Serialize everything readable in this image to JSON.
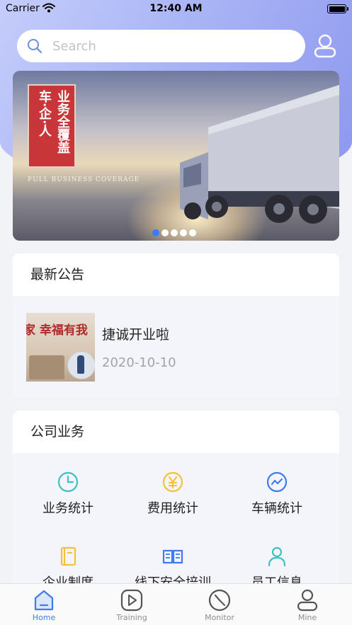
{
  "status_bar": {
    "carrier": "Carrier",
    "time": "12:40 AM",
    "wifi_icon": "wifi-icon",
    "battery_icon": "battery-icon"
  },
  "search": {
    "placeholder": "Search",
    "icon": "search-icon"
  },
  "profile_icon": "user-icon",
  "banner": {
    "seal_col1": "车·企·人",
    "seal_col2": "业务全覆盖",
    "subtitle": "FULL BUSINESS COVERAGE",
    "page_count": 5,
    "active_page": 1
  },
  "notice": {
    "title": "最新公告",
    "items": [
      {
        "thumb_text": "家 幸福有我",
        "title": "捷诚开业啦",
        "date": "2020-10-10"
      }
    ]
  },
  "business": {
    "title": "公司业务",
    "items": [
      {
        "label": "业务统计",
        "icon": "pie-chart-icon",
        "color": "#3fc1c1"
      },
      {
        "label": "费用统计",
        "icon": "yuan-icon",
        "color": "#f3c03a"
      },
      {
        "label": "车辆统计",
        "icon": "trend-icon",
        "color": "#3d7cf0"
      },
      {
        "label": "企业制度",
        "icon": "book-icon",
        "color": "#f3c03a"
      },
      {
        "label": "线下安全培训",
        "icon": "open-book-icon",
        "color": "#3d7cf0"
      },
      {
        "label": "员工信息",
        "icon": "person-icon",
        "color": "#3fc1c1"
      }
    ]
  },
  "tabbar": {
    "active": "Home",
    "items": [
      {
        "label": "Home",
        "icon": "home-icon"
      },
      {
        "label": "Training",
        "icon": "play-icon"
      },
      {
        "label": "Monitor",
        "icon": "gauge-icon"
      },
      {
        "label": "Mine",
        "icon": "user-icon"
      }
    ]
  },
  "colors": {
    "accent": "#3d7cf0",
    "header_gradient_start": "#c5cdfb",
    "header_gradient_end": "#8d97ef"
  }
}
